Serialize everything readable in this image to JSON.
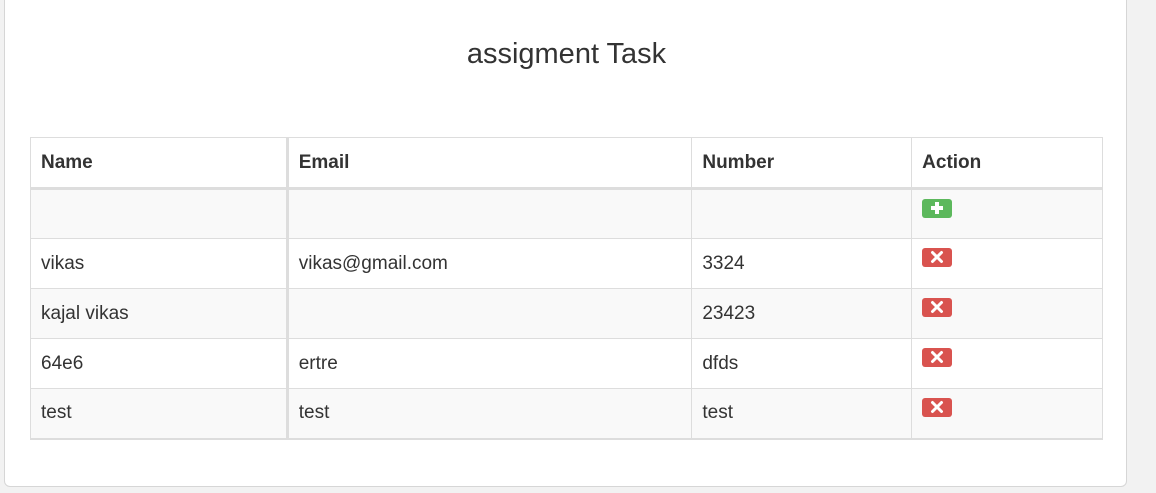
{
  "page": {
    "title": "assigment Task"
  },
  "table": {
    "headers": {
      "name": "Name",
      "email": "Email",
      "number": "Number",
      "action": "Action"
    },
    "rows": [
      {
        "name": "vikas",
        "email": "vikas@gmail.com",
        "number": "3324"
      },
      {
        "name": "kajal vikas",
        "email": "",
        "number": "23423"
      },
      {
        "name": "64e6",
        "email": "ertre",
        "number": "dfds"
      },
      {
        "name": "test",
        "email": "test",
        "number": "test"
      }
    ]
  },
  "icons": {
    "add": "plus-icon",
    "remove": "close-icon"
  },
  "colors": {
    "add_button": "#5cb85c",
    "remove_button": "#d9534f"
  }
}
